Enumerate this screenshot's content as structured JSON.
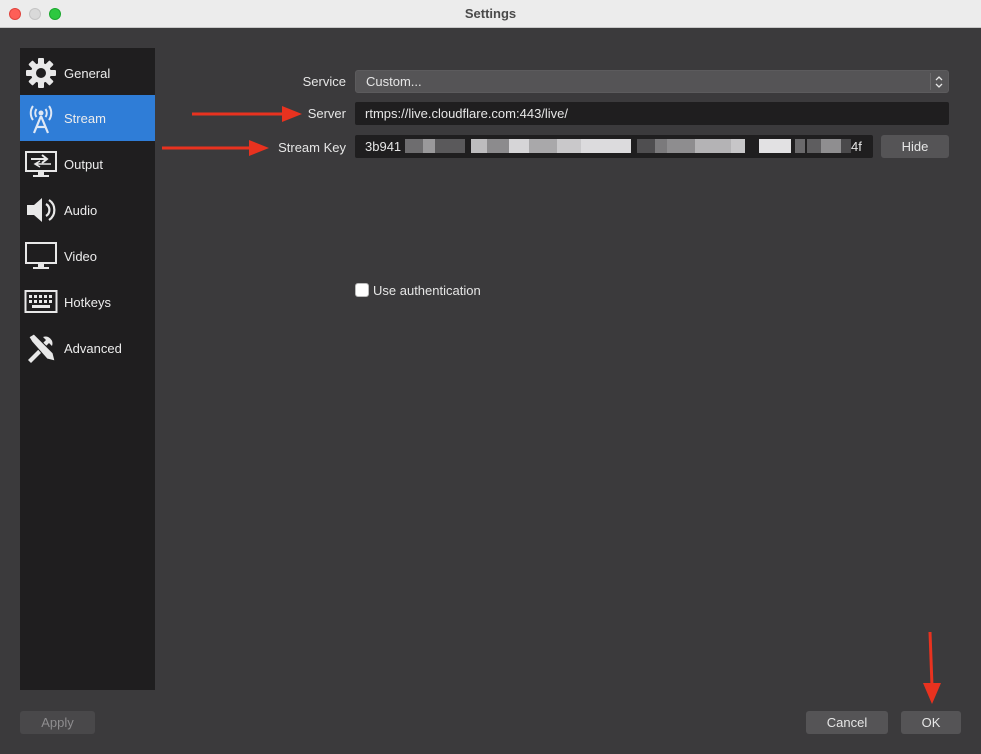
{
  "window": {
    "title": "Settings"
  },
  "sidebar": {
    "items": [
      {
        "label": "General",
        "icon": "gear-icon",
        "active": false
      },
      {
        "label": "Stream",
        "icon": "antenna-icon",
        "active": true
      },
      {
        "label": "Output",
        "icon": "output-icon",
        "active": false
      },
      {
        "label": "Audio",
        "icon": "speaker-icon",
        "active": false
      },
      {
        "label": "Video",
        "icon": "monitor-icon",
        "active": false
      },
      {
        "label": "Hotkeys",
        "icon": "keyboard-icon",
        "active": false
      },
      {
        "label": "Advanced",
        "icon": "tools-icon",
        "active": false
      }
    ]
  },
  "stream": {
    "service_label": "Service",
    "service_value": "Custom...",
    "server_label": "Server",
    "server_value": "rtmps://live.cloudflare.com:443/live/",
    "stream_key_label": "Stream Key",
    "stream_key_prefix": "3b941",
    "stream_key_suffix": "4f",
    "hide_button": "Hide",
    "use_auth_label": "Use authentication",
    "use_auth_checked": false
  },
  "footer": {
    "apply": "Apply",
    "cancel": "Cancel",
    "ok": "OK"
  },
  "colors": {
    "accent": "#2f7dd7",
    "annotation_arrow": "#e8321f"
  }
}
